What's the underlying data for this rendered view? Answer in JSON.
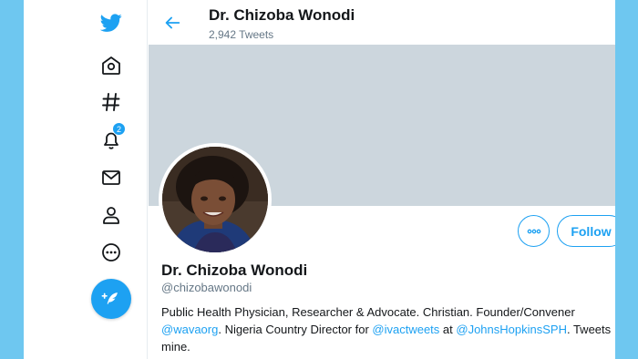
{
  "sidebar": {
    "notifications_badge": "2"
  },
  "header": {
    "name": "Dr. Chizoba Wonodi",
    "tweet_count": "2,942 Tweets"
  },
  "profile": {
    "name": "Dr. Chizoba Wonodi",
    "handle": "@chizobawonodi",
    "follow_label": "Follow",
    "bio": {
      "t1": "Public Health Physician, Researcher & Advocate. Christian. Founder/Convener ",
      "m1": "@wavaorg",
      "t2": ". Nigeria Country Director for ",
      "m2": "@ivactweets",
      "t3": " at ",
      "m3": "@JohnsHopkinsSPH",
      "t4": ". Tweets mine."
    }
  },
  "colors": {
    "accent": "#1da1f2",
    "background": "#6ec7f0",
    "banner": "#ccd6dd"
  },
  "icons": [
    "twitter-bird-icon",
    "home-icon",
    "explore-hashtag-icon",
    "notifications-bell-icon",
    "messages-envelope-icon",
    "profile-person-icon",
    "more-circle-icon",
    "compose-quill-icon",
    "back-arrow-icon",
    "more-options-icon"
  ]
}
